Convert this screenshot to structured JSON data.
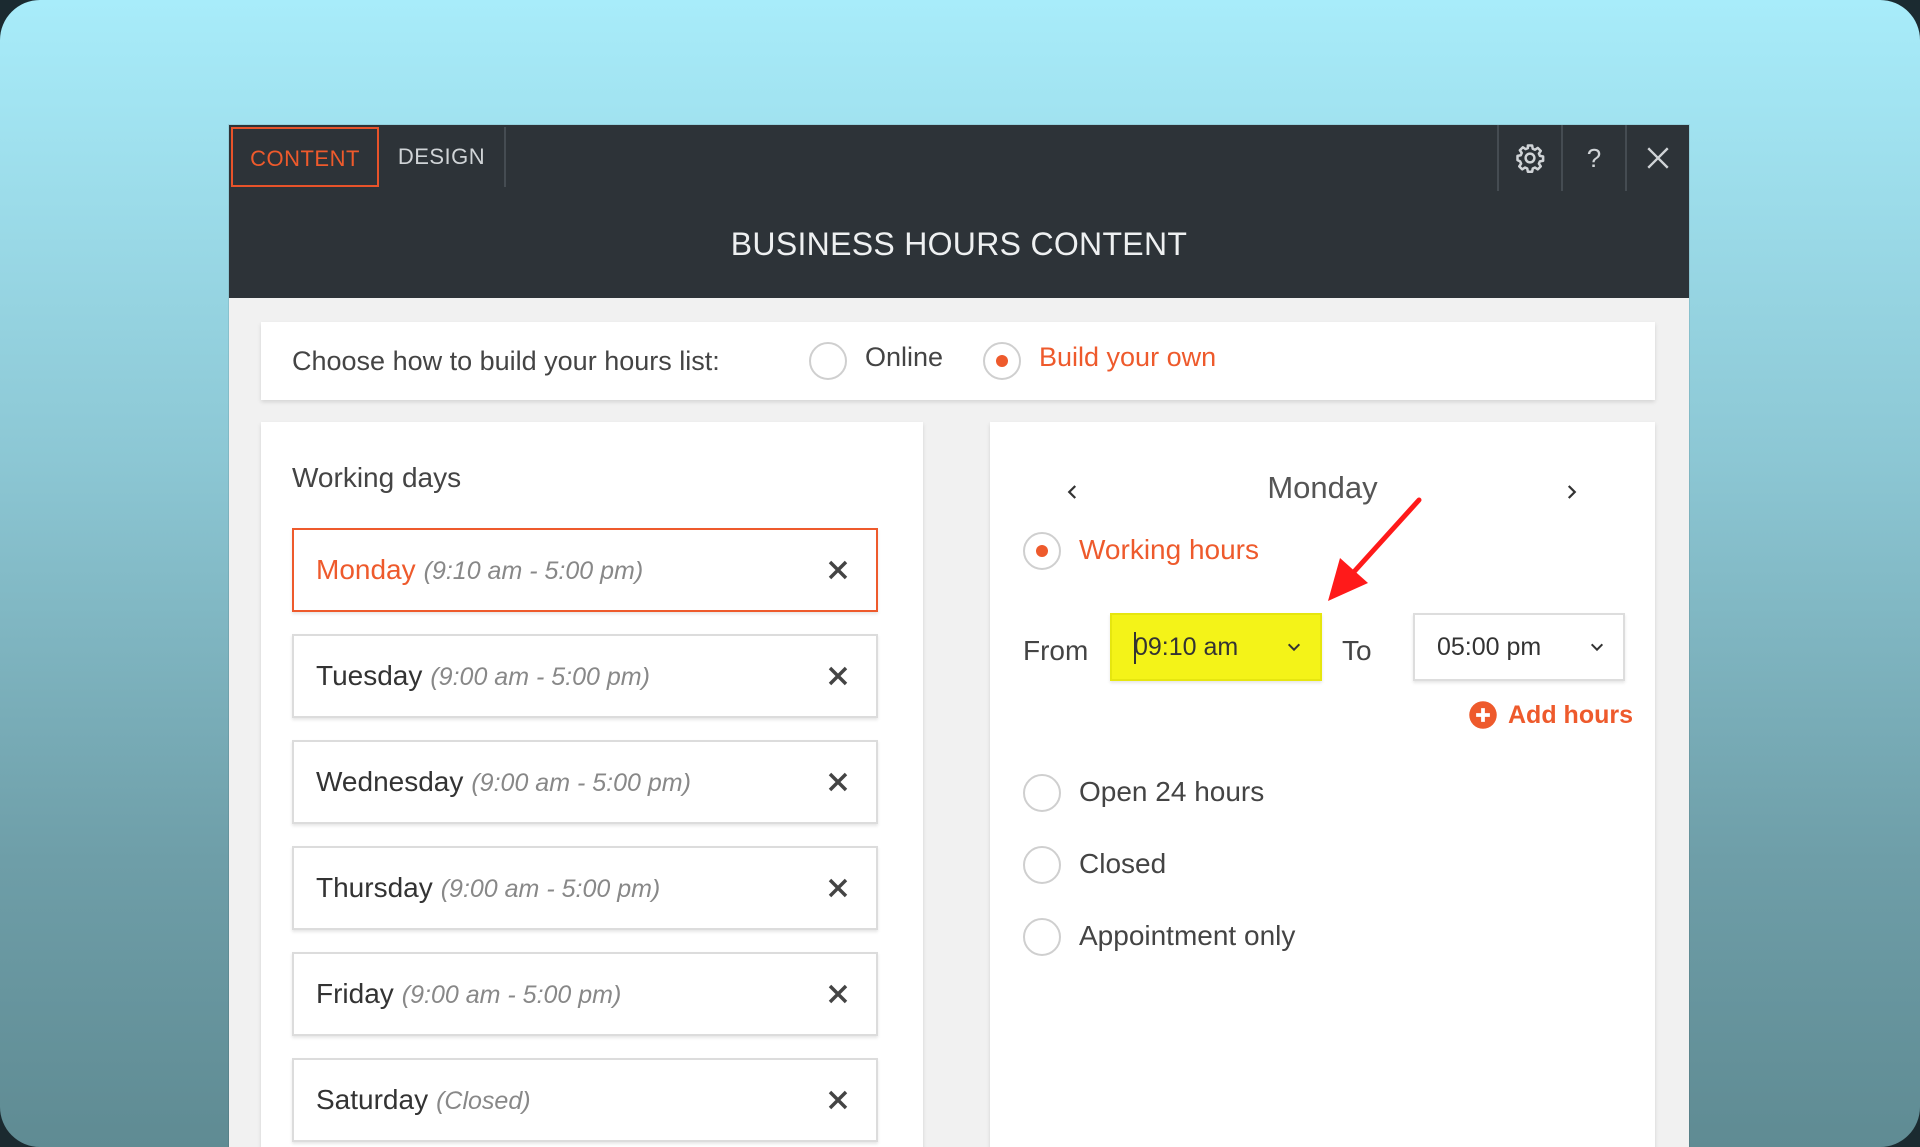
{
  "tabs": {
    "content": "CONTENT",
    "design": "DESIGN"
  },
  "toolbar": {
    "help_label": "?"
  },
  "header": {
    "title": "BUSINESS HOURS CONTENT"
  },
  "build_choice": {
    "label": "Choose how to build your hours list:",
    "options": [
      {
        "label": "Online",
        "selected": false
      },
      {
        "label": "Build your own",
        "selected": true
      }
    ]
  },
  "working_days": {
    "title": "Working days",
    "days": [
      {
        "name": "Monday",
        "hours": "(9:10 am - 5:00 pm)",
        "selected": true
      },
      {
        "name": "Tuesday",
        "hours": "(9:00 am - 5:00 pm)",
        "selected": false
      },
      {
        "name": "Wednesday",
        "hours": "(9:00 am - 5:00 pm)",
        "selected": false
      },
      {
        "name": "Thursday",
        "hours": "(9:00 am - 5:00 pm)",
        "selected": false
      },
      {
        "name": "Friday",
        "hours": "(9:00 am - 5:00 pm)",
        "selected": false
      },
      {
        "name": "Saturday",
        "hours": "(Closed)",
        "selected": false
      }
    ]
  },
  "day_detail": {
    "day": "Monday",
    "working_hours_label": "Working hours",
    "from_label": "From",
    "from_value": "09:10 am",
    "to_label": "To",
    "to_value": "05:00 pm",
    "add_hours_label": "Add hours",
    "options": [
      {
        "label": "Open 24 hours",
        "selected": false
      },
      {
        "label": "Closed",
        "selected": false
      },
      {
        "label": "Appointment only",
        "selected": false
      }
    ]
  },
  "colors": {
    "accent": "#ee5a2c",
    "dark_bar": "#2d3338",
    "highlight": "#f4f318",
    "annotation_arrow": "#ff1a1a"
  }
}
